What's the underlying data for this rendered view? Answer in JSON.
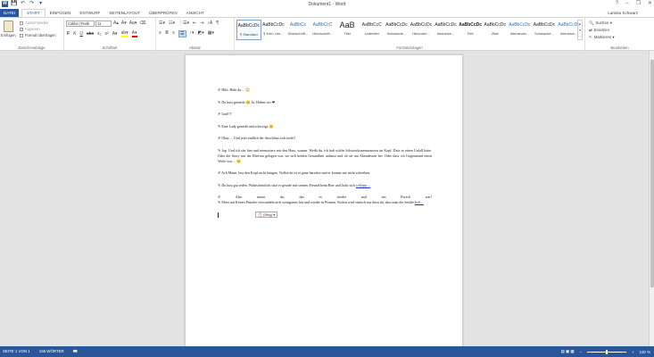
{
  "window": {
    "title": "Dokument1 - Word",
    "user": "Larissa Schwarz"
  },
  "qat": {
    "logo": "W",
    "save": "💾",
    "undo": "↶",
    "redo": "↷",
    "customize": "▾"
  },
  "winctl": {
    "help": "?",
    "minimize": "–",
    "restore": "❐",
    "close": "✕"
  },
  "tabs": {
    "file": "DATEI",
    "items": [
      "START",
      "EINFÜGEN",
      "ENTWURF",
      "SEITENLAYOUT",
      "ÜBERPRÜFEN",
      "ANSICHT"
    ]
  },
  "clipboard": {
    "paste": "Einfügen",
    "cut": "Ausschneiden",
    "copy": "Kopieren",
    "format": "Format übertragen",
    "label": "Zwischenablage"
  },
  "font": {
    "name": "Calibri (Textk",
    "size": "11",
    "label": "Schriftart",
    "row1": [
      "A▴",
      "A▾",
      "Aa▾",
      "⌫"
    ],
    "bold": "F",
    "italic": "K",
    "underline": "U",
    "strike": "abc",
    "sub": "x₂",
    "sup": "x²",
    "effects": "A▾",
    "highlight": "ab▾",
    "color": "A▾"
  },
  "paragraph": {
    "label": "Absatz",
    "row1": [
      "☰▾",
      "☷▾",
      "⋮☰▾",
      "⇤",
      "⇥",
      "↕A",
      "¶"
    ],
    "row2": [
      "≡",
      "≣",
      "≡",
      "☰",
      "↕▾",
      "◩▾",
      "▦▾"
    ]
  },
  "styles": {
    "label": "Formatvorlagen",
    "up": "▴",
    "down": "▾",
    "more": "⋯",
    "items": [
      {
        "preview": "AaBbCcDc",
        "name": "¶ Standard"
      },
      {
        "preview": "AaBbCcDc",
        "name": "¶ Kein Lee..."
      },
      {
        "preview": "AaBbCc",
        "name": "Überschrift..."
      },
      {
        "preview": "AaBbCcC",
        "name": "Überschrift..."
      },
      {
        "preview": "AaB",
        "name": "Titel"
      },
      {
        "preview": "AaBbCcC",
        "name": "Untertitel"
      },
      {
        "preview": "AaBbCcDc",
        "name": "Schwache..."
      },
      {
        "preview": "AaBbCcDc",
        "name": "Hervorhe..."
      },
      {
        "preview": "AaBbCcDc",
        "name": "Intensive..."
      },
      {
        "preview": "AaBbCcDc",
        "name": "Fett"
      },
      {
        "preview": "AaBbCcDc",
        "name": "Zitat"
      },
      {
        "preview": "AaBbCcDc",
        "name": "Intensives..."
      },
      {
        "preview": "AaBbCcDc",
        "name": "Schwache..."
      },
      {
        "preview": "AaBbCcDc",
        "name": "Intensive..."
      }
    ]
  },
  "editing": {
    "find": "Suchen ▾",
    "replace": "Ersetzen",
    "select": "Markieren ▾",
    "label": "Bearbeiten"
  },
  "document": {
    "p1": "✐ Hihi. Habt du ... 🙄",
    "p2": "✎ Du hast gemerkt 😊 Ja. Haben wir ❤",
    "p3": "✐ Und!!?",
    "p4": "✎ Eine Lady genießt und schweigt. 🙂",
    "p5": "✐ Okay ... Und jetzt endlich der Anschluss sich nicht?",
    "p6": "✎ Jap. Und ich sitz hier und memoriere mir den Hass, warum. Weißt du, ich hab solche Schwierkonzentranzen im Kopf. Dass es einen Unfall hatte. Oder die Story mit der Ehefrau gelogen war, sie sich beiden Gesundheit anhasst und ob sie am Abendessen her. Oder dass ich Gegenstand einen Weile war ... 😟",
    "p7": "✐ Ach Mann, lass den Kopf nicht hängen. Vielleicht ist er ganz harmlos und er konnte nur nicht schreiben.",
    "p8_text": "✎ Du hast gut reden. Wahrscheinlich sitzt er gerade mit seinem Freund beim Bier und lacht sich ",
    "p8_link": "schlapp ...",
    "p9_line1": "✐ Also musst du, das es wieder mal ein Porsch war!",
    "p9_text": "✎ Eben mit Ketten Patzehe verwandeln sich wenigstens hin und wieder in Prinzen. Ketten wird einfach nur dazu da, dass man die Smilie ",
    "p9_link": "holt ...",
    "paste_chip": "📋 (Strg) ▾"
  },
  "status": {
    "page": "SEITE 1 VON 1",
    "words": "165 WÖRTER",
    "proof": "📖",
    "views": "▤  ▣  ▦",
    "zoom_minus": "–",
    "zoom_plus": "+",
    "zoom": "100 %"
  }
}
